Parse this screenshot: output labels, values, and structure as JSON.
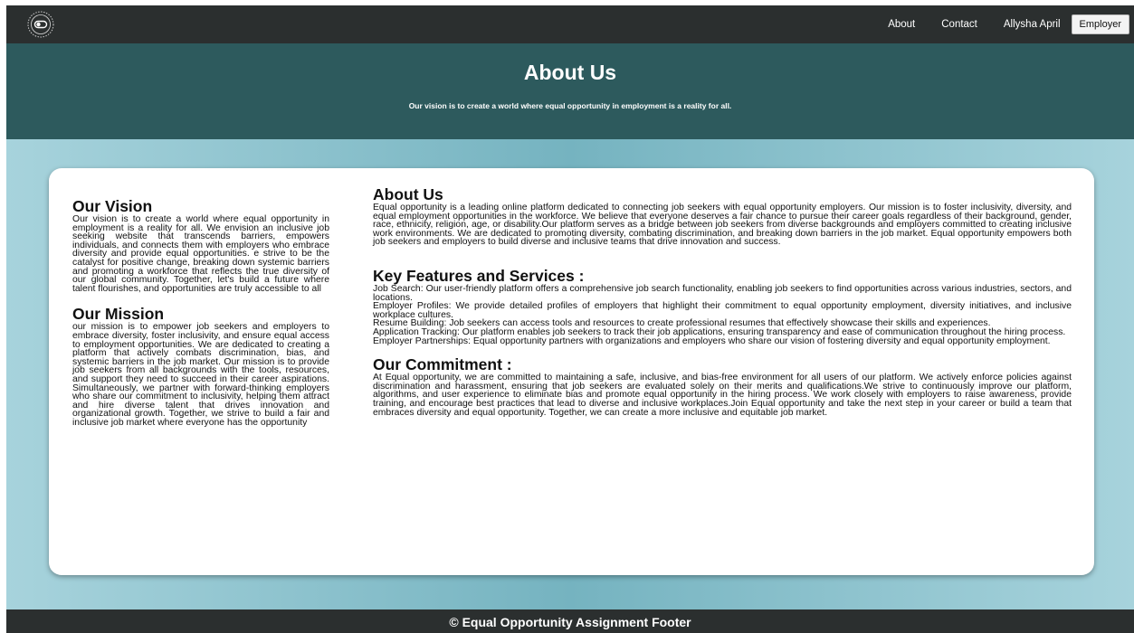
{
  "nav": {
    "logo_icon": "circular-seal-logo",
    "links": [
      "About",
      "Contact",
      "Allysha April"
    ],
    "employer_button": "Employer"
  },
  "hero": {
    "title": "About Us",
    "subtitle": "Our vision is to create a world where equal opportunity in employment is a reality for all."
  },
  "vision": {
    "heading": "Our Vision",
    "text": "Our vision is to create a world where equal opportunity in employment is a reality for all. We envision an inclusive job seeking website that transcends barriers, empowers individuals, and connects them with employers who embrace diversity and provide equal opportunities. e strive to be the catalyst for positive change, breaking down systemic barriers and promoting a workforce that reflects the true diversity of our global community. Together, let's build a future where talent flourishes, and opportunities are truly accessible to all"
  },
  "mission": {
    "heading": "Our Mission",
    "text": "our mission is to empower job seekers and employers to embrace diversity, foster inclusivity, and ensure equal access to employment opportunities. We are dedicated to creating a platform that actively combats discrimination, bias, and systemic barriers in the job market. Our mission is to provide job seekers from all backgrounds with the tools, resources, and support they need to succeed in their career aspirations. Simultaneously, we partner with forward-thinking employers who share our commitment to inclusivity, helping them attract and hire diverse talent that drives innovation and organizational growth. Together, we strive to build a fair and inclusive job market where everyone has the opportunity"
  },
  "about": {
    "heading": "About Us",
    "text": "Equal opportunity is a leading online platform dedicated to connecting job seekers with equal opportunity employers. Our mission is to foster inclusivity, diversity, and equal employment opportunities in the workforce. We believe that everyone deserves a fair chance to pursue their career goals regardless of their background, gender, race, ethnicity, religion, age, or disability.Our platform serves as a bridge between job seekers from diverse backgrounds and employers committed to creating inclusive work environments. We are dedicated to promoting diversity, combating discrimination, and breaking down barriers in the job market. Equal opportunity empowers both job seekers and employers to build diverse and inclusive teams that drive innovation and success."
  },
  "features": {
    "heading": "Key Features and Services :",
    "items": [
      "Job Search: Our user-friendly platform offers a comprehensive job search functionality, enabling job seekers to find opportunities across various industries, sectors, and locations.",
      "Employer Profiles: We provide detailed profiles of employers that highlight their commitment to equal opportunity employment, diversity initiatives, and inclusive workplace cultures.",
      "Resume Building: Job seekers can access tools and resources to create professional resumes that effectively showcase their skills and experiences.",
      "Application Tracking: Our platform enables job seekers to track their job applications, ensuring transparency and ease of communication throughout the hiring process.",
      "Employer Partnerships: Equal opportunity partners with organizations and employers who share our vision of fostering diversity and equal opportunity employment."
    ]
  },
  "commitment": {
    "heading": "Our Commitment :",
    "text": "At Equal opportunity, we are committed to maintaining a safe, inclusive, and bias-free environment for all users of our platform. We actively enforce policies against discrimination and harassment, ensuring that job seekers are evaluated solely on their merits and qualifications.We strive to continuously improve our platform, algorithms, and user experience to eliminate bias and promote equal opportunity in the hiring process. We work closely with employers to raise awareness, provide training, and encourage best practices that lead to diverse and inclusive workplaces.Join Equal opportunity and take the next step in your career or build a team that embraces diversity and equal opportunity. Together, we can create a more inclusive and equitable job market."
  },
  "footer": {
    "text": "© Equal Opportunity Assignment Footer"
  },
  "colors": {
    "nav_bg": "#2b2f2f",
    "hero_bg": "#2d5a5d",
    "band_edge": "#a7d3dc",
    "band_center": "#75b3c0",
    "card_bg": "#ffffff"
  }
}
